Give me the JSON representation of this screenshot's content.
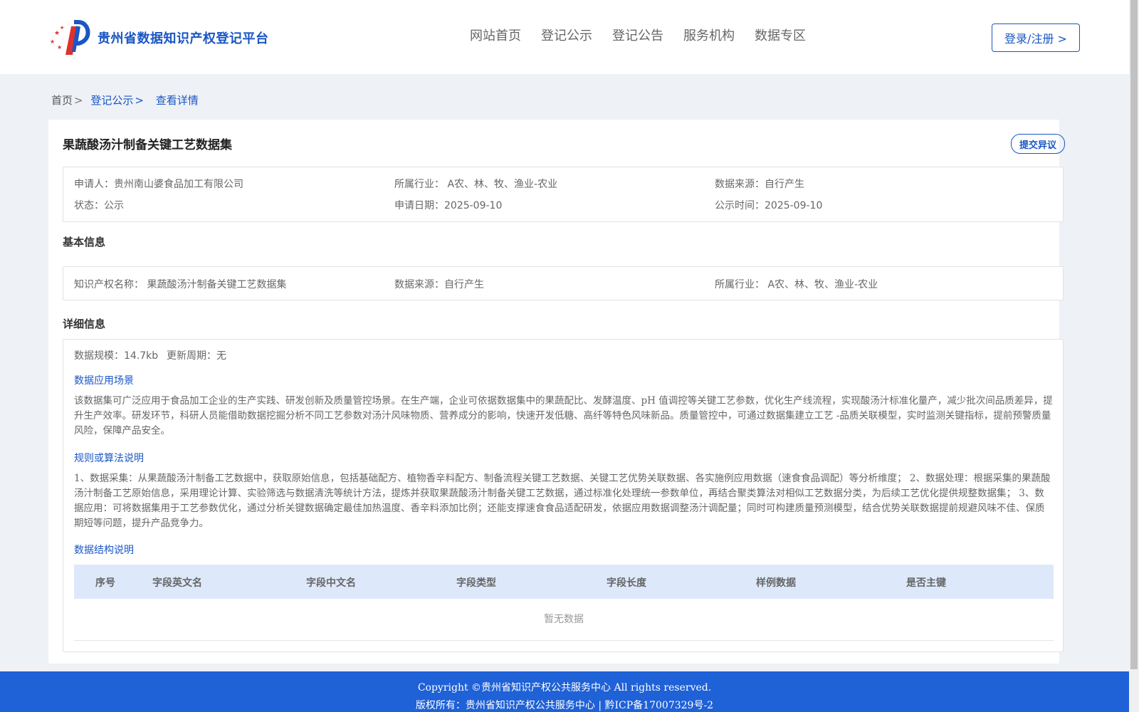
{
  "header": {
    "site_title": "贵州省数据知识产权登记平台",
    "nav": [
      "网站首页",
      "登记公示",
      "登记公告",
      "服务机构",
      "数据专区"
    ],
    "login_label": "登录/注册 >"
  },
  "breadcrumb": {
    "home": "首页",
    "section": "登记公示",
    "current": "查看详情",
    "separator": ">"
  },
  "detail": {
    "title": "果蔬酸汤汁制备关键工艺数据集",
    "objection_label": "提交异议",
    "summary": {
      "applicant": "申请人：贵州南山婆食品加工有限公司",
      "industry": "所属行业： A农、林、牧、渔业-农业",
      "source": "数据来源：自行产生",
      "status": "状态：公示",
      "apply_date": "申请日期：2025-09-10",
      "publish_date": "公示时间：2025-09-10"
    },
    "basic_title": "基本信息",
    "basic": {
      "ip_name": "知识产权名称： 果蔬酸汤汁制备关键工艺数据集",
      "source": "数据来源：自行产生",
      "industry": "所属行业： A农、林、牧、渔业-农业"
    },
    "detail_title": "详细信息",
    "scale": "数据规模：14.7kb",
    "cycle": "更新周期：无",
    "scenario_title": "数据应用场景",
    "scenario_text": "该数据集可广泛应用于食品加工企业的生产实践、研发创新及质量管控场景。在生产端，企业可依据数据集中的果蔬配比、发酵温度、pH 值调控等关键工艺参数，优化生产线流程，实现酸汤汁标准化量产，减少批次间品质差异，提升生产效率。研发环节，科研人员能借助数据挖掘分析不同工艺参数对汤汁风味物质、营养成分的影响，快速开发低糖、高纤等特色风味新品。质量管控中，可通过数据集建立工艺 -品质关联模型，实时监测关键指标，提前预警质量风险，保障产品安全。",
    "rule_title": "规则或算法说明",
    "rule_text": "1、数据采集：从果蔬酸汤汁制备工艺数据中，获取原始信息，包括基础配方、植物香辛料配方、制备流程关键工艺数据、关键工艺优势关联数据、各实施例应用数据（速食食品调配）等分析维度； 2、数据处理：根据采集的果蔬酸汤汁制备工艺原始信息，采用理论计算、实验筛选与数据清洗等统计方法，提炼并获取果蔬酸汤汁制备关键工艺数据，通过标准化处理统一参数单位，再结合聚类算法对相似工艺数据分类，为后续工艺优化提供规整数据集； 3、数据应用：可将数据集用于工艺参数优化，通过分析关键数据确定最佳加热温度、香辛料添加比例；还能支撑速食食品适配研发，依据应用数据调整汤汁调配量；同时可构建质量预测模型，结合优势关联数据提前规避风味不佳、保质期短等问题，提升产品竞争力。",
    "structure_title": "数据结构说明",
    "table_headers": [
      "序号",
      "字段英文名",
      "字段中文名",
      "字段类型",
      "字段长度",
      "样例数据",
      "是否主键"
    ],
    "empty_text": "暂无数据"
  },
  "footer": {
    "copyright": "Copyright ©贵州省知识产权公共服务中心 All rights reserved.",
    "owner": "版权所有：贵州省知识产权公共服务中心 | 黔ICP备17007329号-2"
  },
  "colors": {
    "brand": "#1a56c4",
    "footer_bg": "#1f61d6",
    "table_head_bg": "#dde9fb",
    "page_bg": "#eef1f5"
  }
}
